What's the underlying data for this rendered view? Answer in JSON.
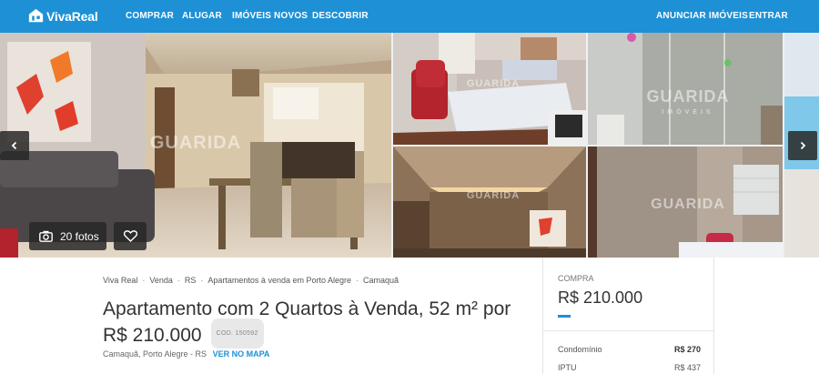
{
  "header": {
    "logo_text": "VivaReal",
    "nav": [
      "COMPRAR",
      "ALUGAR",
      "IMÓVEIS NOVOS",
      "DESCOBRIR"
    ],
    "right_nav": [
      "ANUNCIAR IMÓVEIS",
      "ENTRAR"
    ],
    "bg_color": "#1e90d6"
  },
  "gallery": {
    "photos_count_label": "20 fotos",
    "watermark": "GUARIDA",
    "watermark_sub": "IMÓVEIS",
    "icons": [
      "camera-icon",
      "heart-icon",
      "chevron-left-icon",
      "chevron-right-icon"
    ]
  },
  "breadcrumb": [
    "Viva Real",
    "Venda",
    "RS",
    "Apartamentos à venda em Porto Alegre",
    "Camaquã"
  ],
  "listing": {
    "title": "Apartamento com 2 Quartos à Venda, 52 m² por R$ 210.000",
    "code": "COD. 150592",
    "address": "Camaquã, Porto Alegre - RS",
    "map_link": "VER NO MAPA"
  },
  "price_panel": {
    "label": "COMPRA",
    "price": "R$ 210.000",
    "fees": [
      {
        "label": "Condomínio",
        "value": "R$ 270"
      },
      {
        "label": "IPTU",
        "value": "R$ 437"
      }
    ]
  }
}
